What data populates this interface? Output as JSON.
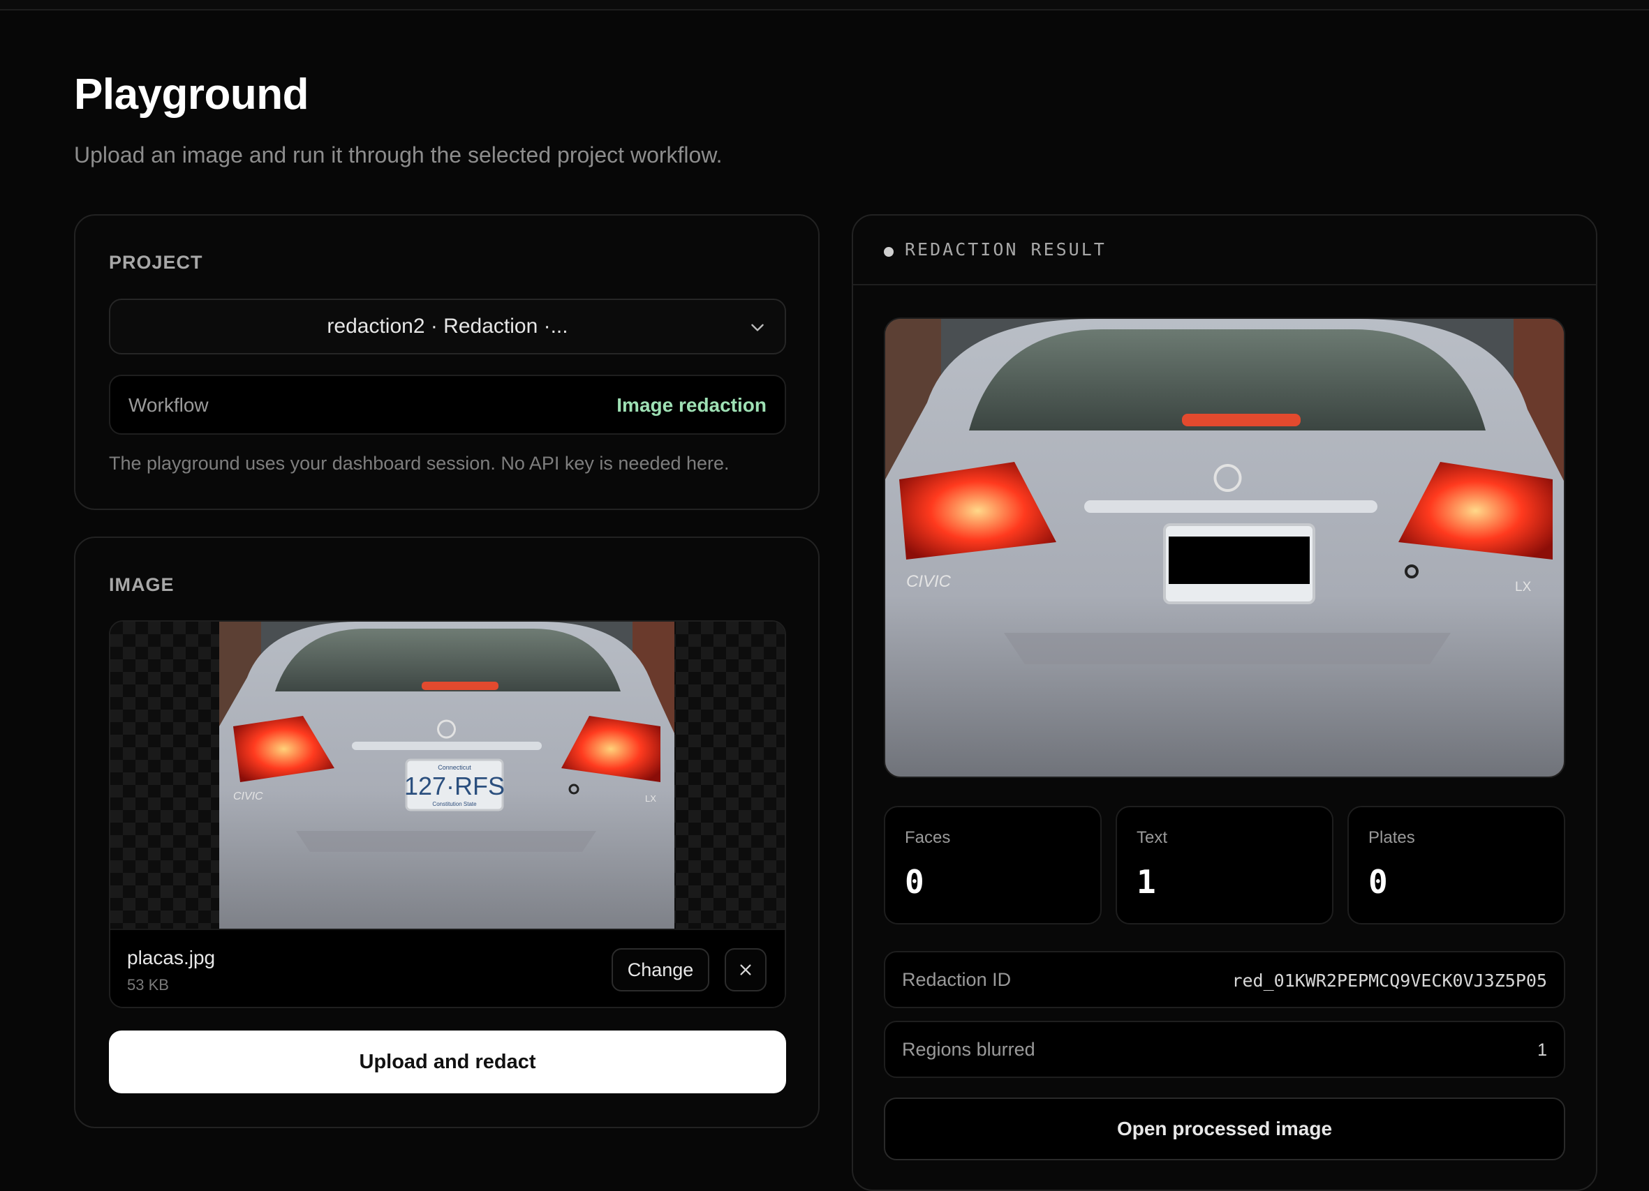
{
  "page": {
    "title": "Playground",
    "subtitle": "Upload an image and run it through the selected project workflow."
  },
  "project_card": {
    "label": "PROJECT",
    "selected_project": "redaction2 · Redaction ·...",
    "workflow_label": "Workflow",
    "workflow_value": "Image redaction",
    "note": "The playground uses your dashboard session. No API key is needed here."
  },
  "image_card": {
    "label": "IMAGE",
    "file_name": "placas.jpg",
    "file_size": "53 KB",
    "change_label": "Change",
    "remove_icon": "close-icon",
    "submit_label": "Upload and redact",
    "plate_text": "127·RFS",
    "plate_state": "Connecticut",
    "plate_motto": "Constitution State",
    "car_model": "CIVIC",
    "car_trim": "LX"
  },
  "result_card": {
    "title": "REDACTION RESULT",
    "stats": [
      {
        "label": "Faces",
        "value": "0"
      },
      {
        "label": "Text",
        "value": "1"
      },
      {
        "label": "Plates",
        "value": "0"
      }
    ],
    "redaction_id_label": "Redaction ID",
    "redaction_id_value": "red_01KWR2PEPMCQ9VECK0VJ3Z5P05",
    "regions_label": "Regions blurred",
    "regions_value": "1",
    "open_label": "Open processed image"
  },
  "colors": {
    "background": "#070707",
    "accent_green": "#9ee0b4",
    "primary_button": "#ffffff"
  }
}
